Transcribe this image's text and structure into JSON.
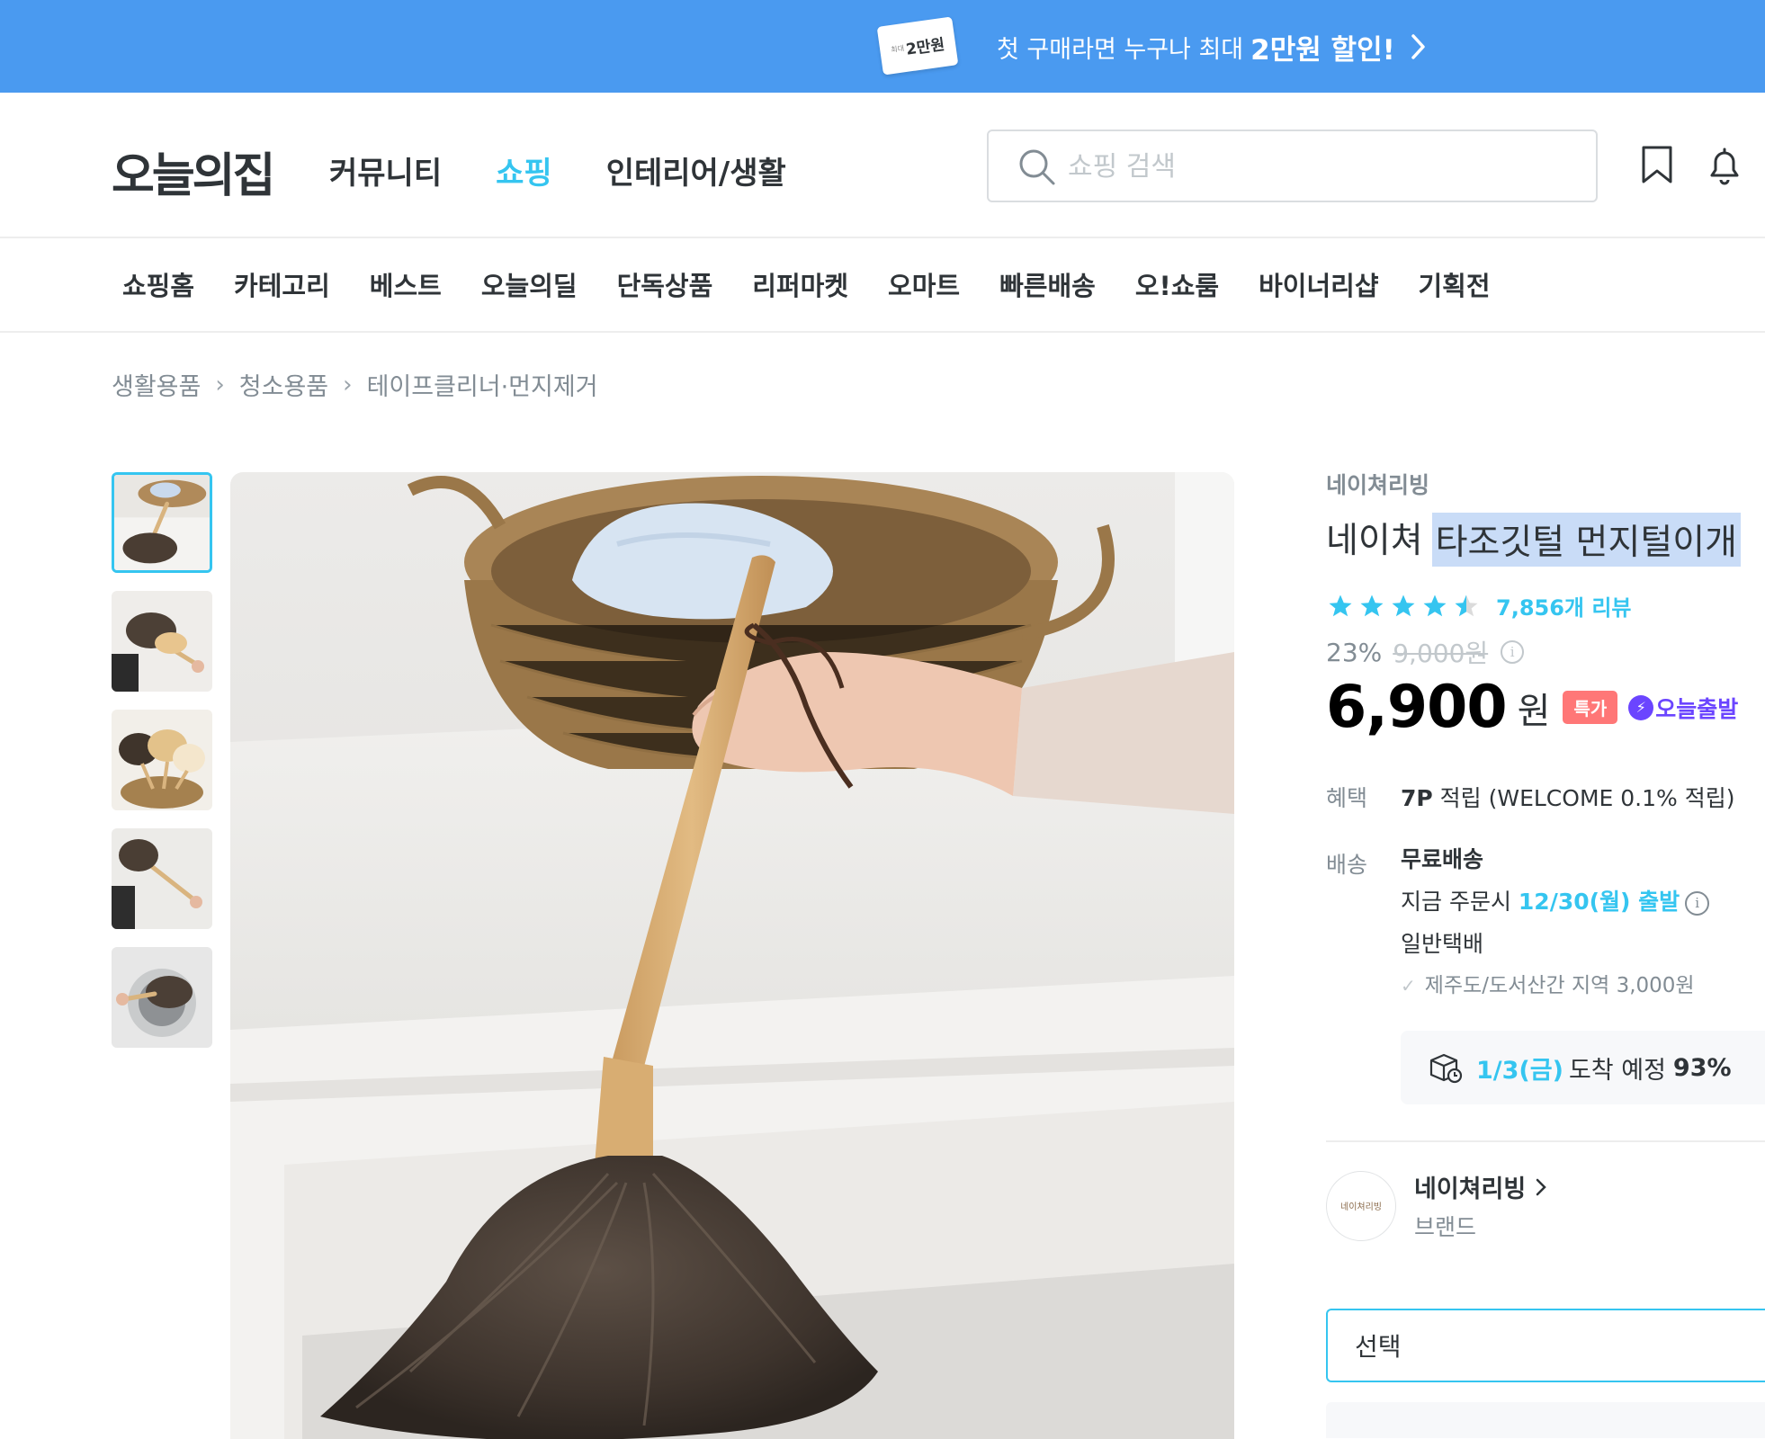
{
  "banner": {
    "coupon_small": "최대",
    "coupon_amount": "2만원",
    "message": "첫 구매라면 누구나 최대",
    "message_bold": "2만원 할인!"
  },
  "header": {
    "logo": "오늘의집",
    "nav": [
      {
        "label": "커뮤니티",
        "active": false
      },
      {
        "label": "쇼핑",
        "active": true
      },
      {
        "label": "인테리어/생활",
        "active": false
      }
    ],
    "search_placeholder": "쇼핑 검색",
    "icons": [
      "bookmark-icon",
      "bell-icon"
    ]
  },
  "subnav": [
    "쇼핑홈",
    "카테고리",
    "베스트",
    "오늘의딜",
    "단독상품",
    "리퍼마켓",
    "오마트",
    "빠른배송",
    "오!쇼룸",
    "바이너리샵",
    "기획전"
  ],
  "breadcrumb": [
    "생활용품",
    "청소용품",
    "테이프클리너·먼지제거"
  ],
  "product": {
    "brand": "네이쳐리빙",
    "name_plain": "네이쳐",
    "name_highlighted": "타조깃털 먼지털이개",
    "rating": 4.5,
    "review_count": "7,856개 리뷰",
    "discount_pct": "23%",
    "original_price": "9,000원",
    "price": "6,900",
    "price_unit": "원",
    "badge_special": "특가",
    "badge_fast": "오늘출발",
    "benefit_label": "혜택",
    "benefit_points": "7P",
    "benefit_text": " 적립 (WELCOME 0.1% 적립)",
    "shipping_label": "배송",
    "shipping_free": "무료배송",
    "ship_prefix": "지금 주문시 ",
    "ship_date": "12/30(월) 출발",
    "ship_method": "일반택배",
    "ship_extra": "제주도/도서산간 지역 3,000원",
    "arrival_date": "1/3(금)",
    "arrival_text": "도착 예정",
    "arrival_pct": "93%",
    "brand_name": "네이쳐리빙",
    "brand_sub": "브랜드",
    "brand_logo_text": "네이쳐리빙",
    "select_label": "선택"
  },
  "colors": {
    "banner_bg": "#4a9af0",
    "accent": "#35c5f0",
    "special_badge": "#ff7777",
    "fast_badge": "#6b45ff"
  }
}
